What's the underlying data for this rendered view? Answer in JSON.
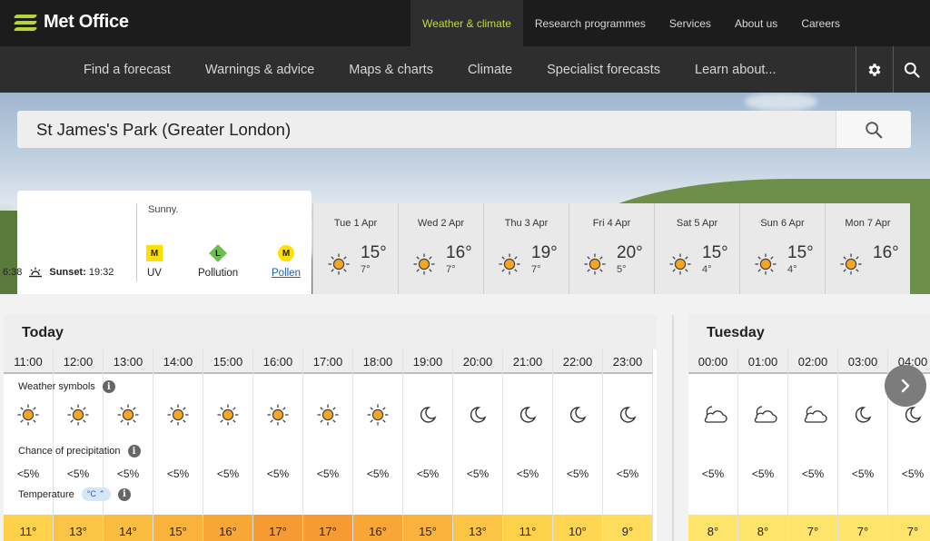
{
  "header": {
    "logo_text": "Met Office",
    "top_nav": [
      "Weather & climate",
      "Research programmes",
      "Services",
      "About us",
      "Careers"
    ],
    "main_nav": [
      "Find a forecast",
      "Warnings & advice",
      "Maps & charts",
      "Climate",
      "Specialist forecasts",
      "Learn about..."
    ]
  },
  "search": {
    "value": "St James's Park (Greater London)"
  },
  "today_card": {
    "sunrise_partial": "6:38",
    "sunset_label": "Sunset:",
    "sunset_time": "19:32",
    "summary": "Sunny.",
    "uv": {
      "badge": "M",
      "label": "UV"
    },
    "pollution": {
      "badge": "L",
      "label": "Pollution"
    },
    "pollen": {
      "badge": "M",
      "label": "Pollen"
    }
  },
  "days": [
    {
      "label": "Tue 1 Apr",
      "high": "15°",
      "low": "7°"
    },
    {
      "label": "Wed 2 Apr",
      "high": "16°",
      "low": "7°"
    },
    {
      "label": "Thu 3 Apr",
      "high": "19°",
      "low": "7°"
    },
    {
      "label": "Fri 4 Apr",
      "high": "20°",
      "low": "5°"
    },
    {
      "label": "Sat 5 Apr",
      "high": "15°",
      "low": "4°"
    },
    {
      "label": "Sun 6 Apr",
      "high": "15°",
      "low": "4°"
    },
    {
      "label": "Mon 7 Apr",
      "high": "16°",
      "low": ""
    }
  ],
  "labels": {
    "weather_symbols": "Weather symbols",
    "precipitation": "Chance of precipitation",
    "temperature": "Temperature",
    "unit": "°C",
    "info": "i"
  },
  "today": {
    "title": "Today",
    "hours": [
      {
        "time": "11:00",
        "sym": "sun",
        "rain": "<5%",
        "temp": "11°"
      },
      {
        "time": "12:00",
        "sym": "sun",
        "rain": "<5%",
        "temp": "13°"
      },
      {
        "time": "13:00",
        "sym": "sun",
        "rain": "<5%",
        "temp": "14°"
      },
      {
        "time": "14:00",
        "sym": "sun",
        "rain": "<5%",
        "temp": "15°"
      },
      {
        "time": "15:00",
        "sym": "sun",
        "rain": "<5%",
        "temp": "16°"
      },
      {
        "time": "16:00",
        "sym": "sun",
        "rain": "<5%",
        "temp": "17°"
      },
      {
        "time": "17:00",
        "sym": "sun",
        "rain": "<5%",
        "temp": "17°"
      },
      {
        "time": "18:00",
        "sym": "sun",
        "rain": "<5%",
        "temp": "16°"
      },
      {
        "time": "19:00",
        "sym": "moon",
        "rain": "<5%",
        "temp": "15°"
      },
      {
        "time": "20:00",
        "sym": "moon",
        "rain": "<5%",
        "temp": "13°"
      },
      {
        "time": "21:00",
        "sym": "moon",
        "rain": "<5%",
        "temp": "11°"
      },
      {
        "time": "22:00",
        "sym": "moon",
        "rain": "<5%",
        "temp": "10°"
      },
      {
        "time": "23:00",
        "sym": "moon",
        "rain": "<5%",
        "temp": "9°"
      }
    ]
  },
  "tuesday": {
    "title": "Tuesday",
    "hours": [
      {
        "time": "00:00",
        "sym": "cloud",
        "rain": "<5%",
        "temp": "8°"
      },
      {
        "time": "01:00",
        "sym": "cloud",
        "rain": "<5%",
        "temp": "8°"
      },
      {
        "time": "02:00",
        "sym": "cloud",
        "rain": "<5%",
        "temp": "7°"
      },
      {
        "time": "03:00",
        "sym": "moon",
        "rain": "<5%",
        "temp": "7°"
      },
      {
        "time": "04:00",
        "sym": "moon",
        "rain": "<5%",
        "temp": "7°"
      }
    ]
  },
  "colors": {
    "accent": "#c5db3a",
    "temp_scale": {
      "7": "#ffe46b",
      "8": "#ffe46b",
      "9": "#ffdc5c",
      "10": "#ffd652",
      "11": "#ffd04a",
      "13": "#fcc444",
      "14": "#fbbd40",
      "15": "#f9b23b",
      "16": "#f8a635",
      "17": "#f59b32"
    }
  }
}
